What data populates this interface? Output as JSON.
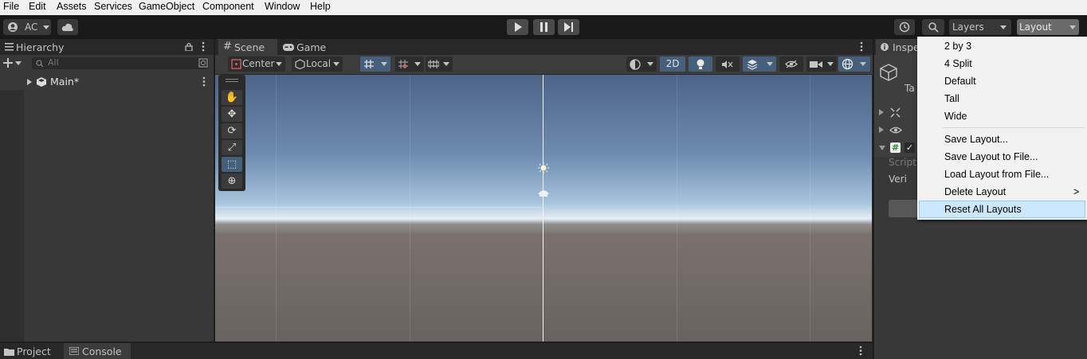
{
  "menubar": {
    "items": [
      "File",
      "Edit",
      "Assets",
      "Services",
      "GameObject",
      "Component",
      "Window",
      "Help"
    ]
  },
  "toolbar": {
    "account_label": "AC",
    "layers_label": "Layers",
    "layout_label": "Layout",
    "icons": [
      "account-icon",
      "cloud-icon",
      "play-icon",
      "pause-icon",
      "step-icon",
      "history-icon",
      "search-icon"
    ]
  },
  "hierarchy": {
    "tab_label": "Hierarchy",
    "search_placeholder": "All",
    "scene_item": "Main*"
  },
  "scene": {
    "tabs": [
      "Scene",
      "Game"
    ],
    "pivot_label": "Center",
    "space_label": "Local",
    "mode_2d": "2D"
  },
  "inspector": {
    "tab_label": "Inspe",
    "field_script": "Script",
    "field_veri": "Veri",
    "name_partial": "Ta"
  },
  "bottom": {
    "tabs": [
      "Project",
      "Console"
    ]
  },
  "layout_menu": {
    "items": [
      "2 by 3",
      "4 Split",
      "Default",
      "Tall",
      "Wide",
      "Save Layout...",
      "Save Layout to File...",
      "Load Layout from File...",
      "Delete Layout",
      "Reset All Layouts"
    ],
    "highlighted": "Reset All Layouts",
    "submenu_arrow": ">"
  },
  "colors": {
    "accent": "#46607c",
    "menu_highlight": "#cce8ff",
    "panel_bg": "#383838"
  }
}
